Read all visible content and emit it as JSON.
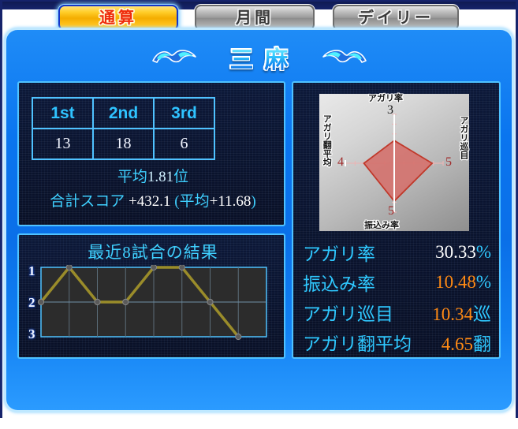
{
  "tabs": [
    {
      "label": "通算",
      "active": true
    },
    {
      "label": "月間",
      "active": false
    },
    {
      "label": "デイリー",
      "active": false
    }
  ],
  "header": {
    "title": "三麻",
    "left_ornament": "wave-icon",
    "right_ornament": "wave-icon"
  },
  "rank_table": {
    "headers": [
      "1st",
      "2nd",
      "3rd"
    ],
    "values": [
      "13",
      "18",
      "6"
    ]
  },
  "summary": {
    "average_prefix": "平均",
    "average_value": "1.81",
    "average_suffix": "位",
    "score_label": "合計スコア",
    "score_value": "+432.1",
    "score_avg_open": "(平均",
    "score_avg_value": "+11.68",
    "score_avg_close": ")"
  },
  "recent": {
    "title": "最近8試合の結果"
  },
  "radar": {
    "axes": [
      {
        "label": "アガリ率",
        "value": "3",
        "color": "#1a1a1a",
        "position": "top"
      },
      {
        "label": "アガリ巡目",
        "value": "5",
        "color": "#a02b2b",
        "position": "right"
      },
      {
        "label": "振込み率",
        "value": "5",
        "color": "#a02b2b",
        "position": "bottom"
      },
      {
        "label": "アガリ翻平均",
        "value": "4",
        "color": "#a02b2b",
        "position": "left"
      }
    ]
  },
  "stats": [
    {
      "name": "アガリ率",
      "value": "30.33",
      "unit": "%",
      "value_color": "#ffffff"
    },
    {
      "name": "振込み率",
      "value": "10.48",
      "unit": "%",
      "value_color": "#ff8a14"
    },
    {
      "name": "アガリ巡目",
      "value": "10.34",
      "unit": "巡",
      "value_color": "#ff8a14"
    },
    {
      "name": "アガリ翻平均",
      "value": "4.65",
      "unit": "翻",
      "value_color": "#ff8a14"
    }
  ],
  "chart_data": [
    {
      "type": "line",
      "title": "最近8試合の結果",
      "x": [
        1,
        2,
        3,
        4,
        5,
        6,
        7,
        8
      ],
      "values": [
        2,
        1,
        2,
        2,
        1,
        1,
        2,
        3
      ],
      "xlabel": "",
      "ylabel": "",
      "ytick_labels": [
        "1",
        "2",
        "3"
      ],
      "ylim": [
        1,
        3
      ],
      "y_inverted": true,
      "grid": true,
      "legend": "none",
      "line_color": "#9a8c2a",
      "marker_color": "#5a5a5a"
    },
    {
      "type": "radar",
      "title": "",
      "categories": [
        "アガリ率",
        "アガリ巡目",
        "振込み率",
        "アガリ翻平均"
      ],
      "values": [
        3,
        5,
        5,
        4
      ],
      "rlim": [
        0,
        10
      ],
      "grid": true,
      "legend": "none",
      "fill_color": "#d4736f",
      "line_color": "#c0392b"
    }
  ],
  "colors": {
    "panel_blue": "#0a75ef",
    "accent_cyan": "#2fc8ff",
    "tab_active_bg": "#f4ad00",
    "tab_active_text": "#ef2b0c",
    "orange_value": "#ff8a14",
    "dark_box": "#0a1430"
  }
}
